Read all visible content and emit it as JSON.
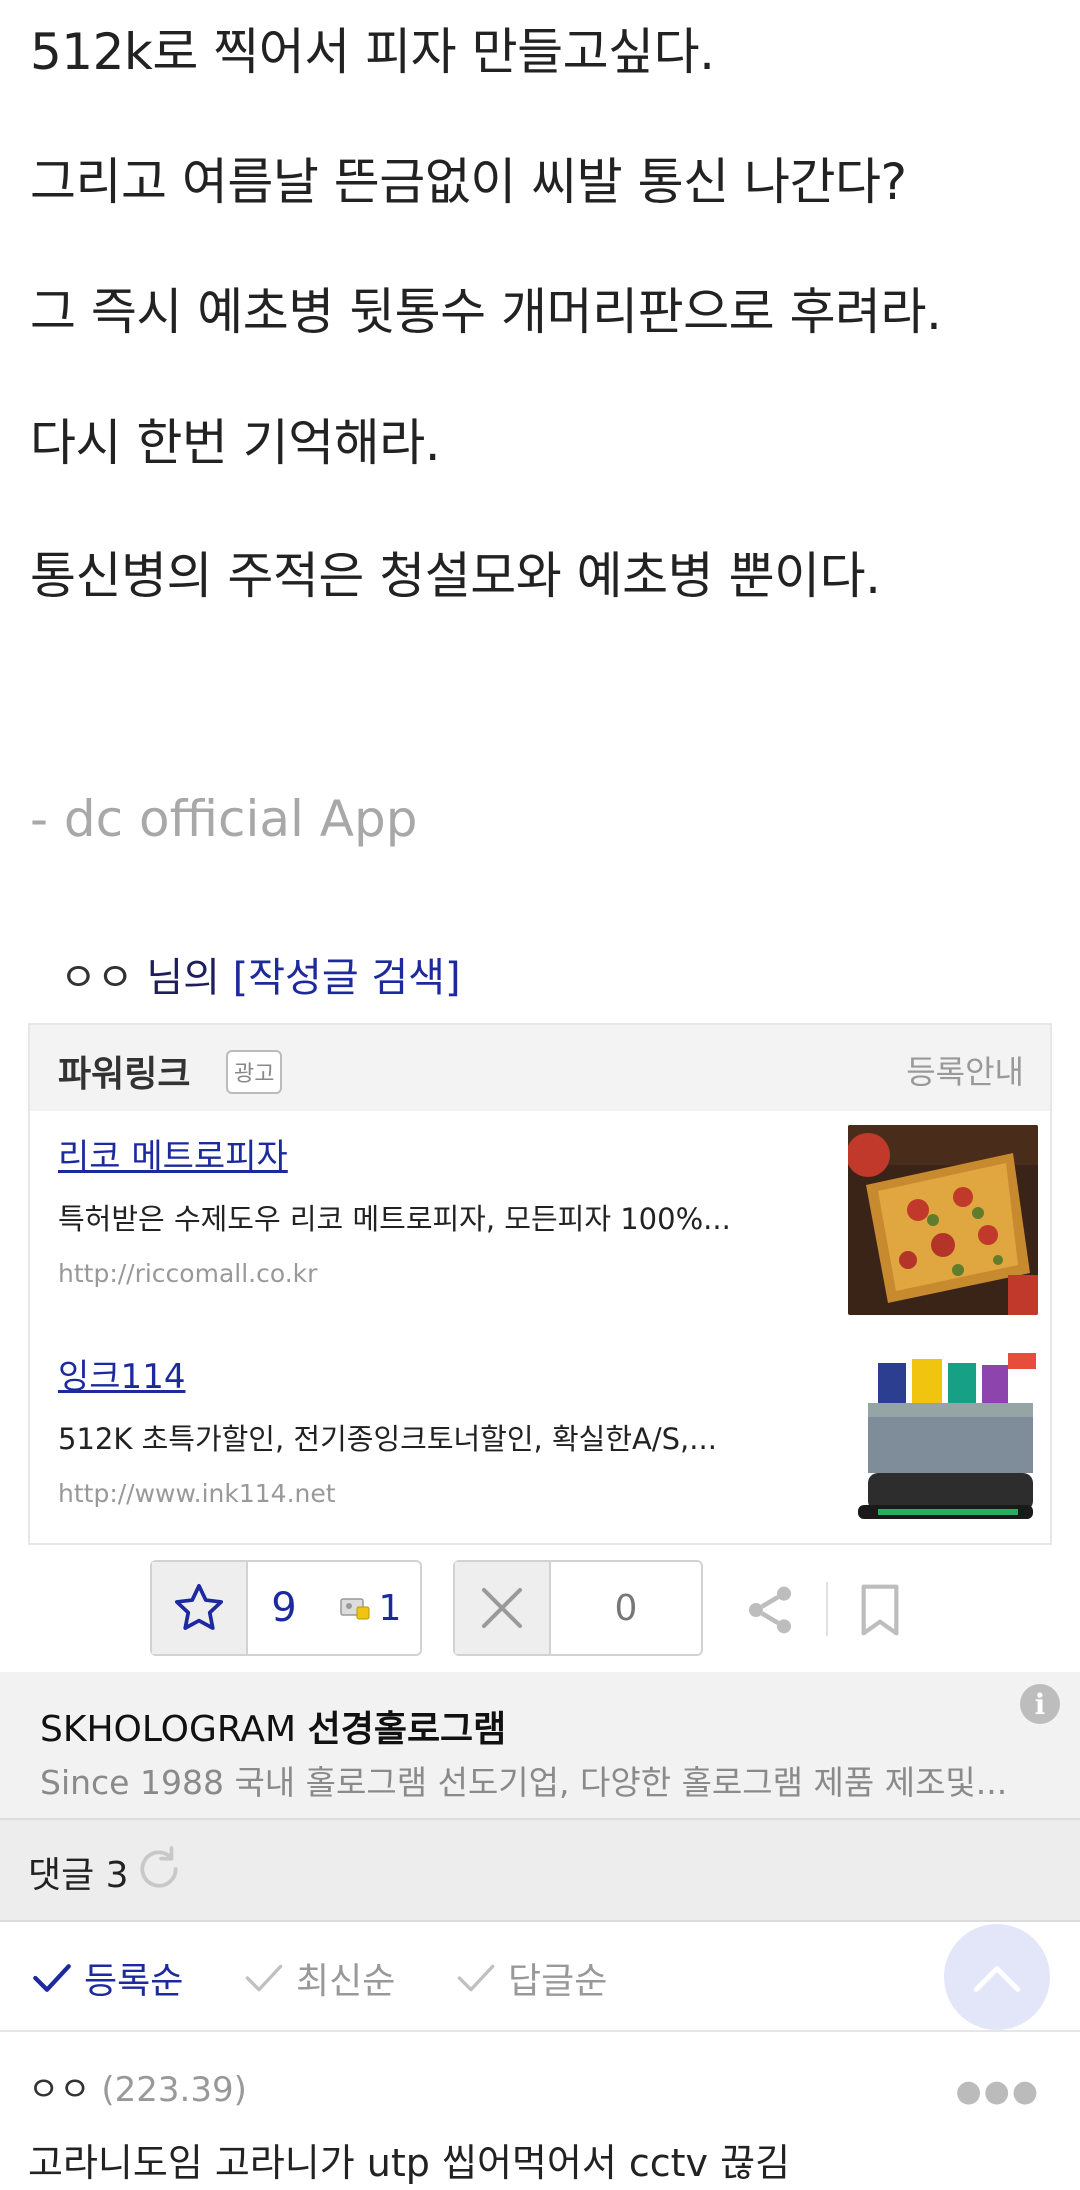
{
  "post": {
    "lines": [
      "512k로 찍어서 피자 만들고싶다.",
      "그리고 여름날 뜬금없이 씨발 통신 나간다?",
      "그 즉시 예초병 뒷통수 개머리판으로 후려라.",
      "다시 한번 기억해라.",
      "통신병의 주적은 청설모와 예초병 뿐이다."
    ],
    "app_signature": "- dc official App"
  },
  "author": {
    "nickname": "ㅇㅇ",
    "suffix": "님의",
    "search_link": "[작성글 검색]"
  },
  "powerlink": {
    "title": "파워링크",
    "badge": "광고",
    "register": "등록안내",
    "ads": [
      {
        "title": "리코 메트로피자",
        "desc": "특허받은 수제도우 리코 메트로피자, 모든피자 100%...",
        "url": "http://riccomall.co.kr",
        "thumb_icon": "pizza-image"
      },
      {
        "title": "잉크114",
        "desc": "512K 초특가할인, 전기종잉크토너할인, 확실한A/S,...",
        "url": "http://www.ink114.net",
        "thumb_icon": "toner-cartridge-image"
      }
    ]
  },
  "reactions": {
    "recommend_count": "9",
    "fixed_count": "1",
    "not_recommend_count": "0"
  },
  "sponsored": {
    "brand": "SKHOLOGRAM",
    "brand_ko": "선경홀로그램",
    "desc": "Since 1988 국내 홀로그램 선도기업, 다양한 홀로그램 제품 제조및...",
    "info_icon": "i"
  },
  "comments_header": {
    "label": "댓글 3"
  },
  "sort": {
    "options": [
      "등록순",
      "최신순",
      "답글순"
    ]
  },
  "comment": {
    "author": "ㅇㅇ",
    "ip": "(223.39)",
    "text": "고라니도임 고라니가 utp 씹어먹어서 cctv 끊김"
  },
  "colors": {
    "accent": "#1d2a9e",
    "muted": "#999999",
    "bar_bg": "#ededed"
  }
}
